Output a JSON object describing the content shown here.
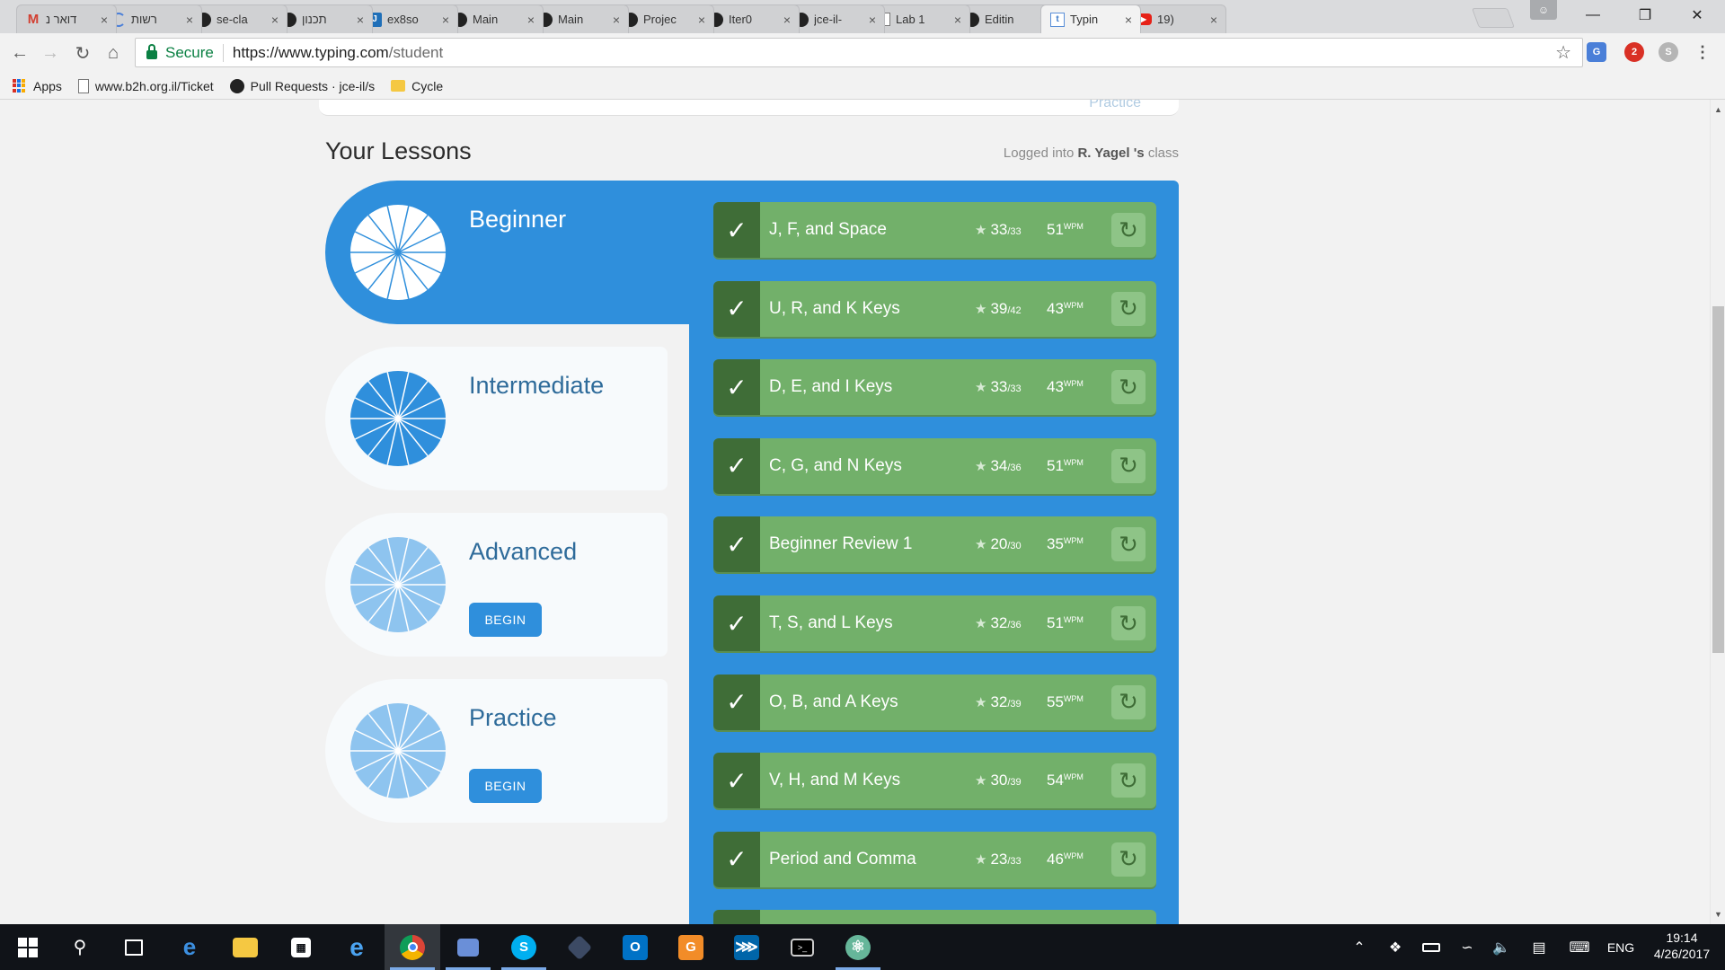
{
  "browser": {
    "tabs": [
      {
        "title": "דואר נ",
        "icon": "gmail-icon",
        "active": false
      },
      {
        "title": "רשות",
        "icon": "loading-icon",
        "active": false
      },
      {
        "title": "se-cla",
        "icon": "github-icon",
        "active": false
      },
      {
        "title": "תכנון",
        "icon": "github-icon",
        "active": false
      },
      {
        "title": "ex8so",
        "icon": "jira-icon",
        "active": false
      },
      {
        "title": "Main",
        "icon": "github-icon",
        "active": false
      },
      {
        "title": "Main",
        "icon": "github-icon",
        "active": false
      },
      {
        "title": "Projec",
        "icon": "github-icon",
        "active": false
      },
      {
        "title": "Iter0",
        "icon": "github-icon",
        "active": false
      },
      {
        "title": "jce-il-",
        "icon": "github-icon",
        "active": false
      },
      {
        "title": "Lab 1",
        "icon": "document-icon",
        "active": false
      },
      {
        "title": "Editin",
        "icon": "github-icon",
        "active": false
      },
      {
        "title": "Typin",
        "icon": "typing-icon",
        "active": true
      },
      {
        "title": "19)",
        "icon": "youtube-icon",
        "active": false
      }
    ],
    "omnibox": {
      "secure_label": "Secure",
      "url_host": "https://www.typing.com",
      "url_path": "/student"
    },
    "bookmarks": [
      {
        "label": "Apps",
        "icon": "apps-icon"
      },
      {
        "label": "www.b2h.org.il/Ticket",
        "icon": "page-icon"
      },
      {
        "label": "Pull Requests · jce-il/s",
        "icon": "github-icon"
      },
      {
        "label": "Cycle",
        "icon": "folder-icon"
      }
    ],
    "extension_badge": "2"
  },
  "page": {
    "top_card_link": "Practice",
    "title": "Your Lessons",
    "logged_in_prefix": "Logged into",
    "class_name": "R. Yagel 's",
    "logged_in_suffix": "class",
    "levels": [
      {
        "name": "Beginner",
        "active": true,
        "button": null
      },
      {
        "name": "Intermediate",
        "active": false,
        "button": null
      },
      {
        "name": "Advanced",
        "active": false,
        "button": "BEGIN"
      },
      {
        "name": "Practice",
        "active": false,
        "button": "BEGIN"
      }
    ],
    "lessons": [
      {
        "name": "J, F, and Space",
        "stars": "33",
        "stars_total": "/33",
        "wpm": "51",
        "wpm_unit": "WPM",
        "completed": true
      },
      {
        "name": "U, R, and K Keys",
        "stars": "39",
        "stars_total": "/42",
        "wpm": "43",
        "wpm_unit": "WPM",
        "completed": true
      },
      {
        "name": "D, E, and I Keys",
        "stars": "33",
        "stars_total": "/33",
        "wpm": "43",
        "wpm_unit": "WPM",
        "completed": true
      },
      {
        "name": "C, G, and N Keys",
        "stars": "34",
        "stars_total": "/36",
        "wpm": "51",
        "wpm_unit": "WPM",
        "completed": true
      },
      {
        "name": "Beginner Review 1",
        "stars": "20",
        "stars_total": "/30",
        "wpm": "35",
        "wpm_unit": "WPM",
        "completed": true
      },
      {
        "name": "T, S, and L Keys",
        "stars": "32",
        "stars_total": "/36",
        "wpm": "51",
        "wpm_unit": "WPM",
        "completed": true
      },
      {
        "name": "O, B, and A Keys",
        "stars": "32",
        "stars_total": "/39",
        "wpm": "55",
        "wpm_unit": "WPM",
        "completed": true
      },
      {
        "name": "V, H, and M Keys",
        "stars": "30",
        "stars_total": "/39",
        "wpm": "54",
        "wpm_unit": "WPM",
        "completed": true
      },
      {
        "name": "Period and Comma",
        "stars": "23",
        "stars_total": "/33",
        "wpm": "46",
        "wpm_unit": "WPM",
        "completed": true
      }
    ]
  },
  "taskbar": {
    "language": "ENG",
    "time": "19:14",
    "date": "4/26/2017"
  },
  "colors": {
    "brand_blue": "#2f8fdc",
    "lesson_green": "#72b06a",
    "check_green": "#3f6d37"
  }
}
